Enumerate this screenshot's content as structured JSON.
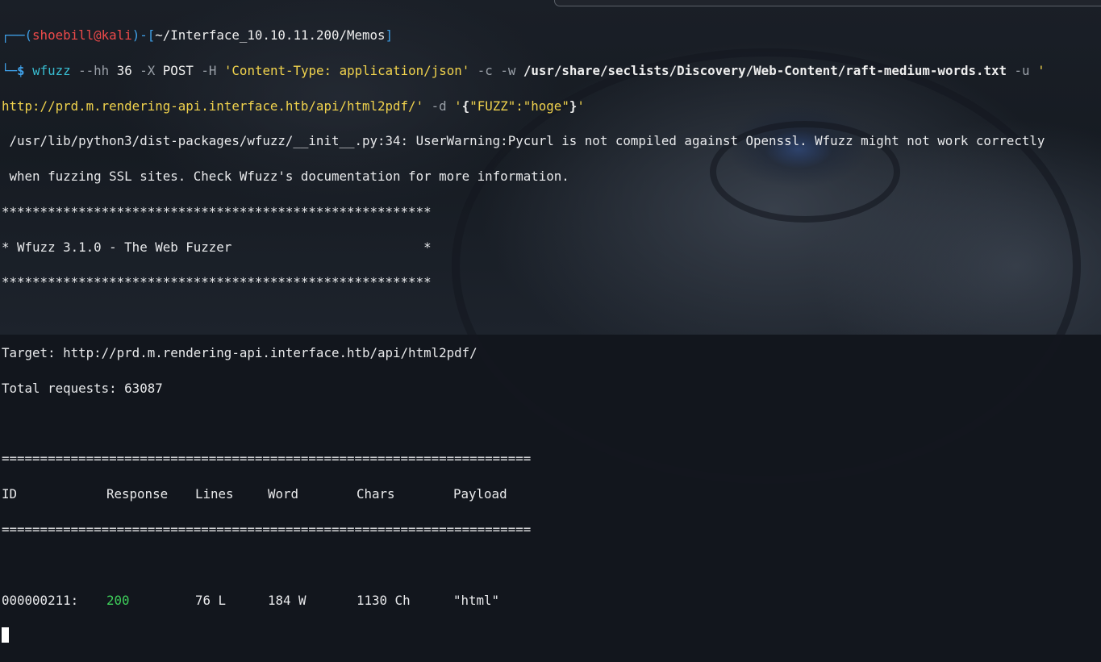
{
  "prompt": {
    "box_top": "┌──(",
    "user": "shoebill",
    "at": "@",
    "host": "kali",
    "sep": ")-[",
    "cwd": "~/Interface_10.10.11.200/Memos",
    "close": "]",
    "box_bottom": "└─",
    "symbol": "$"
  },
  "command": {
    "bin": "wfuzz",
    "opt_hh": "--hh",
    "hh_val": "36",
    "opt_x": "-X",
    "x_val": "POST",
    "opt_h": "-H",
    "h_val": "'Content-Type: application/json'",
    "opt_c": "-c",
    "opt_w": "-w",
    "w_val": "/usr/share/seclists/Discovery/Web-Content/raft-medium-words.txt",
    "opt_u": "-u",
    "u_quote": "'",
    "u_val": "http://prd.m.rendering-api.interface.htb/api/html2pdf/'",
    "opt_d": "-d",
    "d_open": "'",
    "d_brace_open": "{",
    "d_val": "\"FUZZ\":\"hoge\"",
    "d_brace_close": "}",
    "d_close": "'"
  },
  "output": {
    "warning_1": " /usr/lib/python3/dist-packages/wfuzz/__init__.py:34: UserWarning:Pycurl is not compiled against Openssl. Wfuzz might not work correctly",
    "warning_2": " when fuzzing SSL sites. Check Wfuzz's documentation for more information.",
    "stars": "********************************************************",
    "banner": "* Wfuzz 3.1.0 - The Web Fuzzer                         *",
    "target": "Target: http://prd.m.rendering-api.interface.htb/api/html2pdf/",
    "total": "Total requests: 63087",
    "divider": "=====================================================================",
    "headers": [
      "ID",
      "Response",
      "Lines",
      "Word",
      "Chars",
      "Payload"
    ],
    "result": {
      "id": "000000211:",
      "response": "200",
      "lines": "76 L",
      "word": "184 W",
      "chars": "1130 Ch",
      "payload": "\"html\""
    }
  }
}
